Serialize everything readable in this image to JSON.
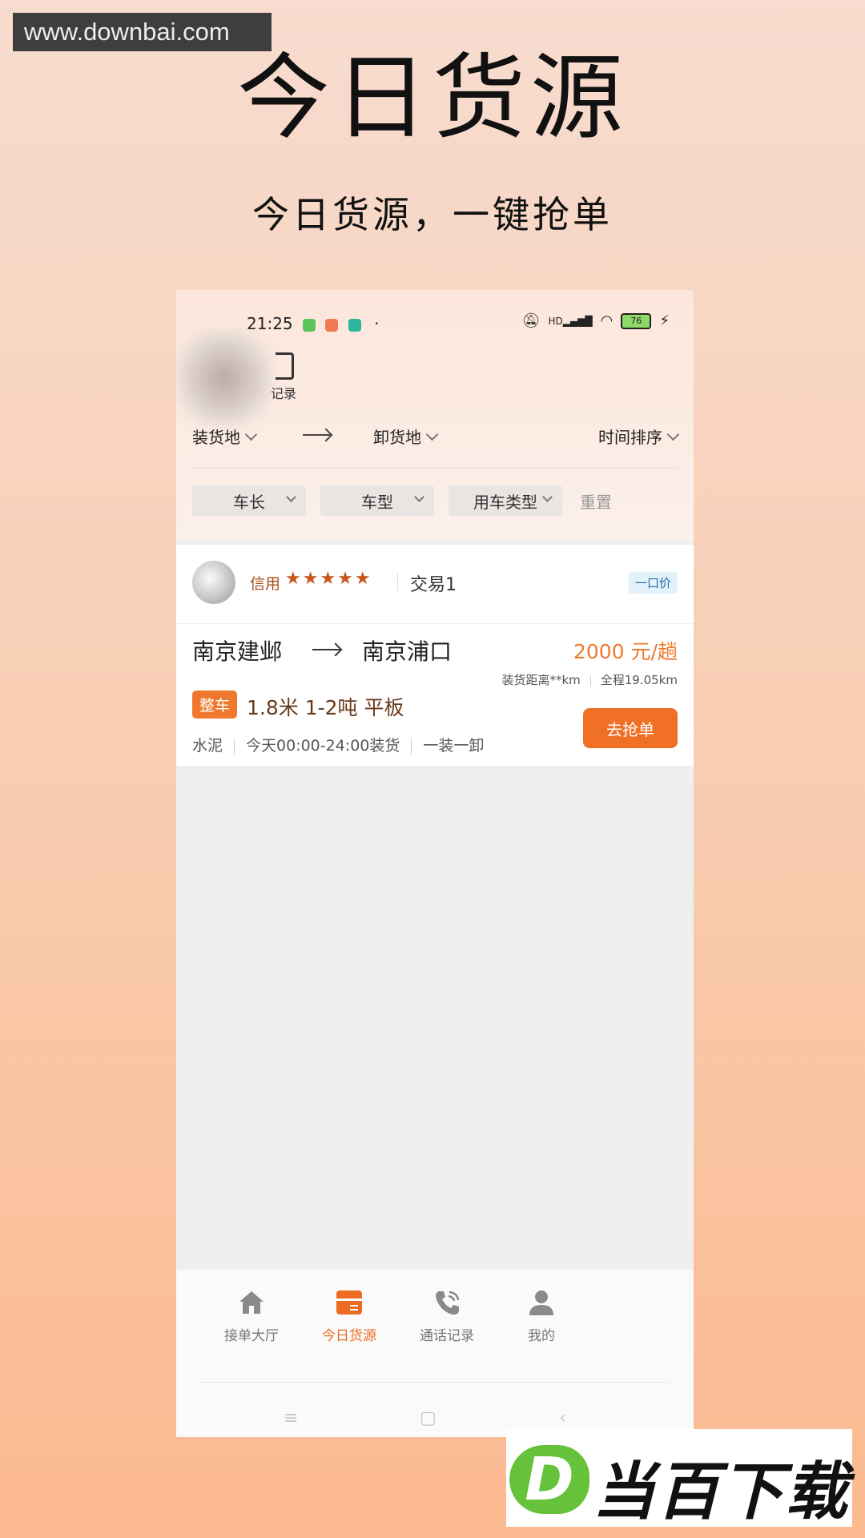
{
  "watermark": {
    "site": "www.downbai.com",
    "brand": "当百下载",
    "brand_letter": "D"
  },
  "promo": {
    "title": "今日货源",
    "subtitle": "今日货源，一键抢单"
  },
  "status_bar": {
    "time": "21:25",
    "battery": "76",
    "signal_label": "HD"
  },
  "header": {
    "record_label": "记录"
  },
  "filters": {
    "load_place": "装货地",
    "unload_place": "卸货地",
    "sort": "时间排序",
    "chips": [
      "车长",
      "车型",
      "用车类型"
    ],
    "reset": "重置"
  },
  "order": {
    "credit_label": "信用",
    "stars": "★★★★★",
    "trade": "交易1",
    "price_type": "一口价",
    "from": "南京建邺",
    "to": "南京浦口",
    "price": "2000 元/趟",
    "load_distance": "装货距离**km",
    "total_distance": "全程19.05km",
    "tag": "整车",
    "spec": "1.8米 1-2吨 平板",
    "cargo": "水泥",
    "load_time": "今天00:00-24:00装货",
    "load_mode": "一装一卸",
    "grab_label": "去抢单"
  },
  "tabs": [
    {
      "label": "接单大厅",
      "icon": "home-icon"
    },
    {
      "label": "今日货源",
      "icon": "cargo-box-icon",
      "active": true
    },
    {
      "label": "通话记录",
      "icon": "phone-icon"
    },
    {
      "label": "我的",
      "icon": "user-icon"
    }
  ],
  "colors": {
    "accent": "#f07026",
    "price": "#ee7a2c",
    "credit": "#a44e1a"
  }
}
